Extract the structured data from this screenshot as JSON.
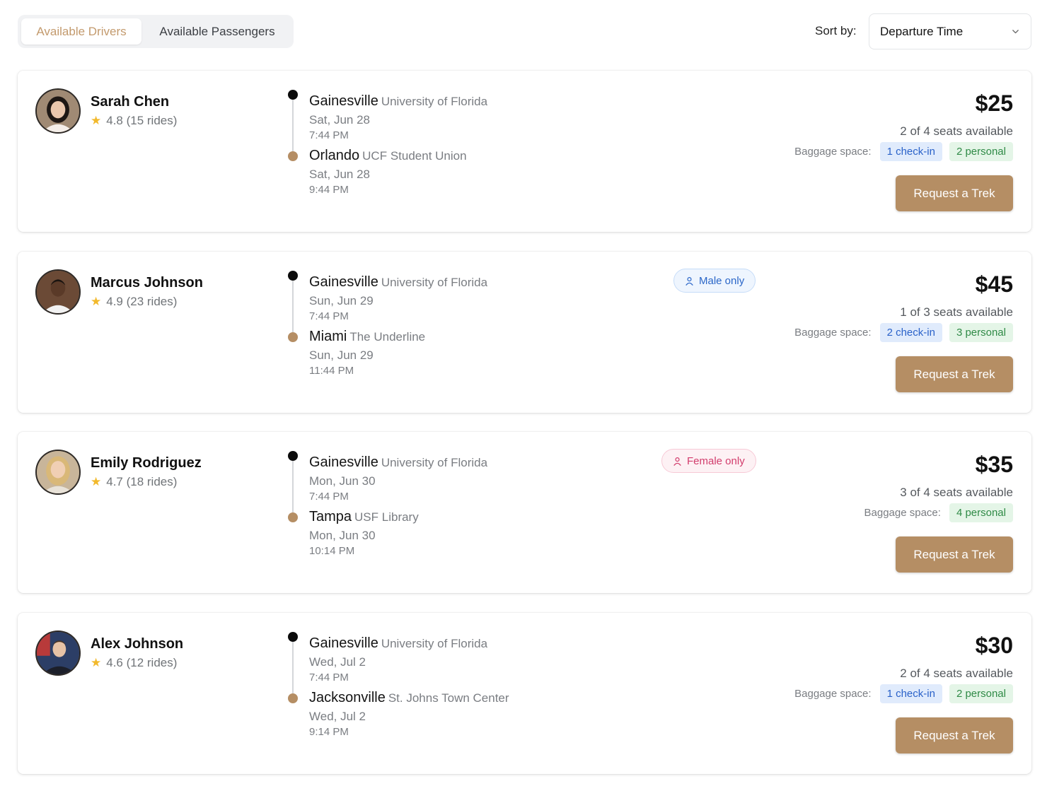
{
  "tabs": {
    "drivers": "Available Drivers",
    "passengers": "Available Passengers"
  },
  "sort": {
    "label": "Sort by:",
    "value": "Departure Time"
  },
  "common": {
    "baggage_label": "Baggage space:",
    "request_label": "Request a Trek"
  },
  "colors": {
    "accent": "#b58e64",
    "tab_active_text": "#c39a6d",
    "star": "#f2b92c",
    "checkin_bg": "#e0ebfc",
    "personal_bg": "#e4f5e7"
  },
  "rides": [
    {
      "name": "Sarah Chen",
      "rating": "4.8 (15 rides)",
      "from_city": "Gainesville",
      "from_place": "University of Florida",
      "from_date": "Sat, Jun 28",
      "from_time": "7:44 PM",
      "to_city": "Orlando",
      "to_place": "UCF Student Union",
      "to_date": "Sat, Jun 28",
      "to_time": "9:44 PM",
      "price": "$25",
      "seats": "2 of 4 seats available",
      "checkin": "1 check-in",
      "personal": "2 personal"
    },
    {
      "name": "Marcus Johnson",
      "rating": "4.9 (23 rides)",
      "from_city": "Gainesville",
      "from_place": "University of Florida",
      "from_date": "Sun, Jun 29",
      "from_time": "7:44 PM",
      "to_city": "Miami",
      "to_place": "The Underline",
      "to_date": "Sun, Jun 29",
      "to_time": "11:44 PM",
      "preference": "Male only",
      "price": "$45",
      "seats": "1 of 3 seats available",
      "checkin": "2 check-in",
      "personal": "3 personal"
    },
    {
      "name": "Emily Rodriguez",
      "rating": "4.7 (18 rides)",
      "from_city": "Gainesville",
      "from_place": "University of Florida",
      "from_date": "Mon, Jun 30",
      "from_time": "7:44 PM",
      "to_city": "Tampa",
      "to_place": "USF Library",
      "to_date": "Mon, Jun 30",
      "to_time": "10:14 PM",
      "preference": "Female only",
      "price": "$35",
      "seats": "3 of 4 seats available",
      "personal": "4 personal"
    },
    {
      "name": "Alex Johnson",
      "rating": "4.6 (12 rides)",
      "from_city": "Gainesville",
      "from_place": "University of Florida",
      "from_date": "Wed, Jul 2",
      "from_time": "7:44 PM",
      "to_city": "Jacksonville",
      "to_place": "St. Johns Town Center",
      "to_date": "Wed, Jul 2",
      "to_time": "9:14 PM",
      "price": "$30",
      "seats": "2 of 4 seats available",
      "checkin": "1 check-in",
      "personal": "2 personal"
    }
  ]
}
